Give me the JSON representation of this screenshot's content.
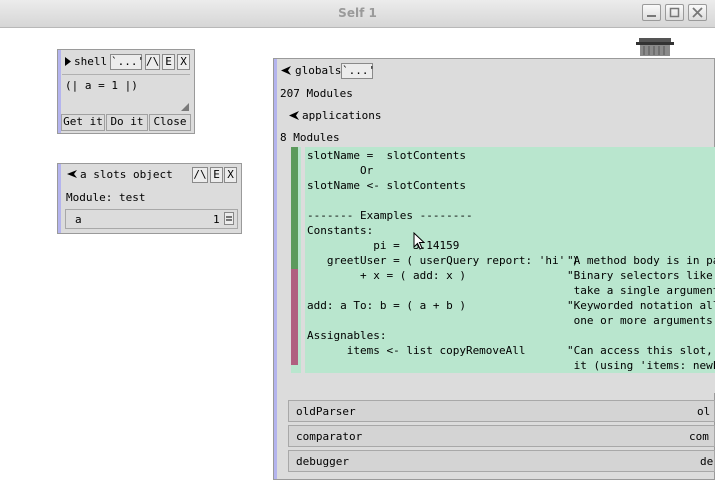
{
  "window": {
    "title": "Self 1"
  },
  "shell": {
    "title": "shell",
    "buttons": [
      "`...'",
      "/\\",
      "E",
      "X"
    ],
    "input": "(| a = 1 |)",
    "actions": {
      "get_it": "Get it",
      "do_it": "Do it",
      "close": "Close"
    }
  },
  "slots_object": {
    "title": "a slots object",
    "buttons": [
      "/\\",
      "E",
      "X"
    ],
    "module": "Module: test",
    "slot": {
      "name": "a",
      "value": "1"
    }
  },
  "globals": {
    "title": "globals",
    "dots": "`...'",
    "module_count": "207 Modules",
    "applications": {
      "title": "applications",
      "module_count": "8 Modules"
    },
    "code_lines": [
      "slotName =  slotContents",
      "        Or",
      "slotName <- slotContents",
      "",
      "------- Examples --------",
      "Constants:",
      "          pi =  3.14159",
      "   greetUser = ( userQuery report: 'hi' )",
      "        + x = ( add: x )",
      "add: a To: b = ( a + b )",
      "",
      "Assignables:",
      "      items <- list copyRemoveAll"
    ],
    "comments": [
      "\"A method body is in pare",
      "\"Binary selectors like + ",
      " take a single argument.",
      "\"Keyworded notation allo",
      " one or more arguments.\"",
      "",
      "\"Can access this slot, o",
      " it (using 'items: newLi"
    ],
    "slot_rows": [
      {
        "name": "oldParser",
        "right": "ol"
      },
      {
        "name": "comparator",
        "right": "com"
      },
      {
        "name": "debugger",
        "right": "de"
      }
    ]
  }
}
